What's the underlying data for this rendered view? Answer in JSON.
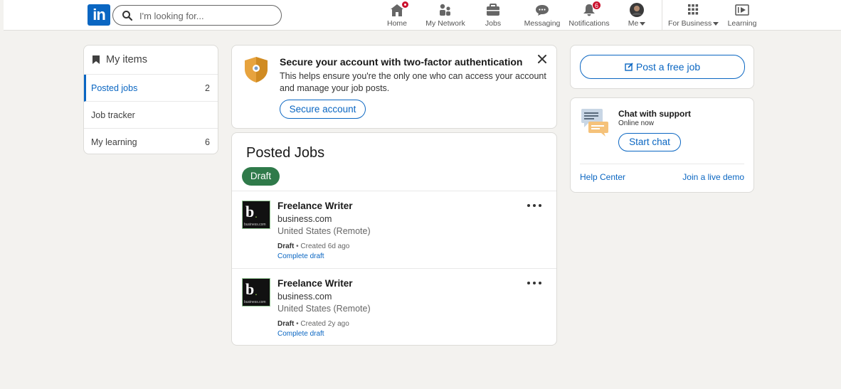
{
  "nav": {
    "logo": "in",
    "search_placeholder": "I'm looking for...",
    "items": [
      {
        "label": "Home",
        "icon": "home-icon",
        "badge": "dot"
      },
      {
        "label": "My Network",
        "icon": "network-icon"
      },
      {
        "label": "Jobs",
        "icon": "briefcase-icon"
      },
      {
        "label": "Messaging",
        "icon": "messaging-icon"
      },
      {
        "label": "Notifications",
        "icon": "bell-icon",
        "badge": "6"
      },
      {
        "label": "Me",
        "icon": "avatar"
      },
      {
        "label": "For Business",
        "icon": "grid-icon"
      },
      {
        "label": "Learning",
        "icon": "learning-icon"
      }
    ]
  },
  "sidebar": {
    "title": "My items",
    "items": [
      {
        "label": "Posted jobs",
        "count": "2"
      },
      {
        "label": "Job tracker",
        "count": ""
      },
      {
        "label": "My learning",
        "count": "6"
      }
    ]
  },
  "tfa": {
    "title": "Secure your account with two-factor authentication",
    "description": "This helps ensure you're the only one who can access your account and manage your job posts.",
    "button": "Secure account"
  },
  "posted_jobs": {
    "title": "Posted Jobs",
    "filter": "Draft",
    "jobs": [
      {
        "title": "Freelance Writer",
        "company": "business.com",
        "location": "United States (Remote)",
        "status": "Draft",
        "created": " • Created 6d ago",
        "action": "Complete draft",
        "logo_letter": "b",
        "logo_dot": ".",
        "logo_sub": "business.com"
      },
      {
        "title": "Freelance Writer",
        "company": "business.com",
        "location": "United States (Remote)",
        "status": "Draft",
        "created": " • Created 2y ago",
        "action": "Complete draft",
        "logo_letter": "b",
        "logo_dot": ".",
        "logo_sub": "business.com"
      }
    ]
  },
  "right": {
    "post_job": "Post a free job",
    "support_title": "Chat with support",
    "support_status": "Online now",
    "start_chat": "Start chat",
    "help_center": "Help Center",
    "live_demo": "Join a live demo"
  },
  "colors": {
    "brand": "#0a66c2",
    "draft_pill": "#2f7a4a",
    "badge": "#cb112d"
  }
}
